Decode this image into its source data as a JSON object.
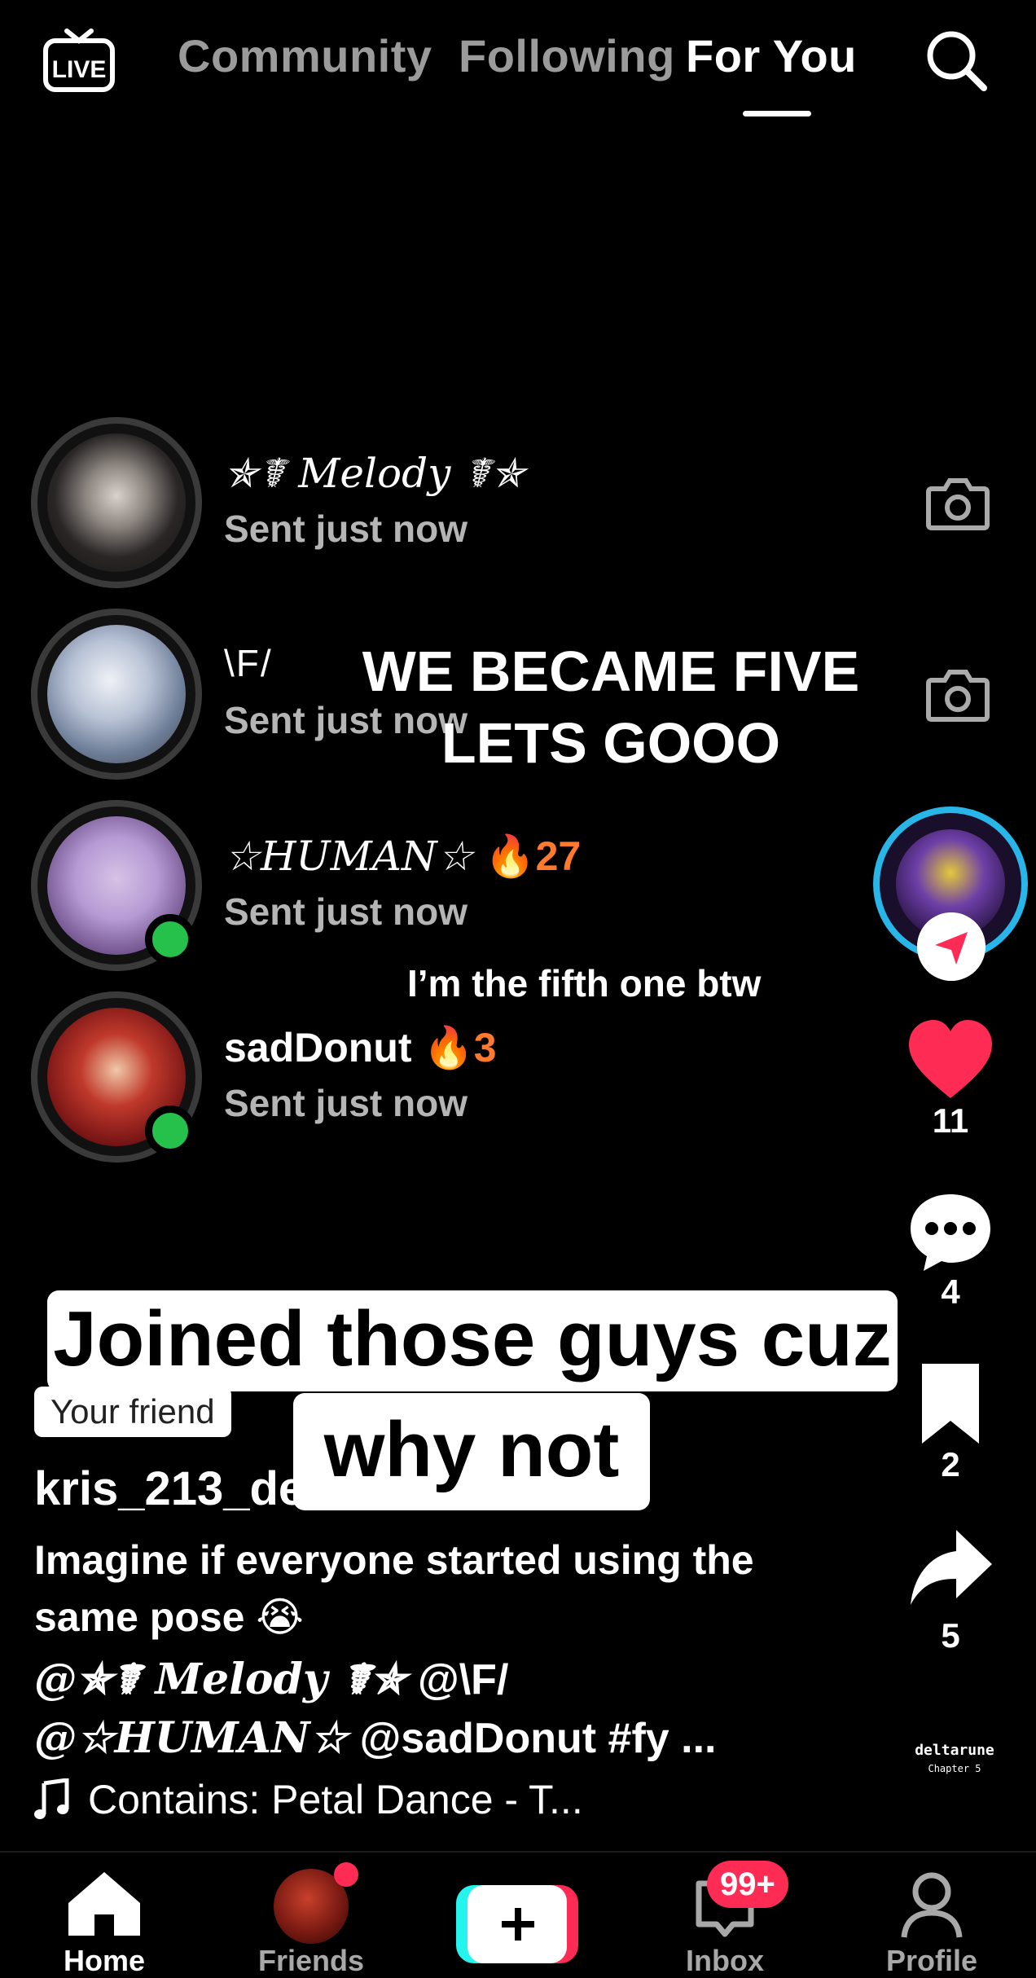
{
  "top_nav": {
    "live_label": "LIVE",
    "tabs": [
      {
        "label": "Community",
        "active": false
      },
      {
        "label": "Following",
        "active": false
      },
      {
        "label": "For You",
        "active": true
      }
    ]
  },
  "chat_list": [
    {
      "name": "✯☤ Melody ☤✯",
      "status": "Sent just now",
      "streak": "",
      "online": false,
      "camera": true
    },
    {
      "name": "\\F/",
      "status": "Sent just now",
      "streak": "",
      "online": false,
      "camera": true
    },
    {
      "name": "☆HUMAN☆",
      "status": "Sent just now",
      "streak": "🔥27",
      "online": true,
      "camera": false
    },
    {
      "name": "sadDonut",
      "status": "Sent just now",
      "streak": "🔥3",
      "online": true,
      "camera": false
    }
  ],
  "video_overlay": {
    "headline": "WE BECAME FIVE LETS GOOO",
    "note": "I’m the fifth one btw"
  },
  "caption": {
    "line1": "Joined those guys cuz",
    "line2": "why not"
  },
  "actions": {
    "likes": "11",
    "comments": "4",
    "bookmarks": "2",
    "shares": "5"
  },
  "post": {
    "friend_badge": "Your friend",
    "username": "kris_213_de",
    "description": "Imagine if everyone started using the same pose 😭",
    "mentions_line1_fancy": "@✯☤ Melody ☤✯",
    "mentions_line1_rest": " @\\F/",
    "mentions_line2_fancy": "@☆HUMAN☆",
    "mentions_line2_rest": " @sadDonut #fy ...",
    "music": "Contains: Petal Dance - T...",
    "watermark_title": "deltarune",
    "watermark_sub": "Chapter 5"
  },
  "bottom_nav": {
    "home": "Home",
    "friends": "Friends",
    "inbox": "Inbox",
    "inbox_badge": "99+",
    "profile": "Profile"
  },
  "colors": {
    "accent_red": "#fe2c55",
    "online_green": "#26c14b",
    "streak_orange": "#ff7a2e",
    "ring_cyan": "#28b6e8"
  }
}
